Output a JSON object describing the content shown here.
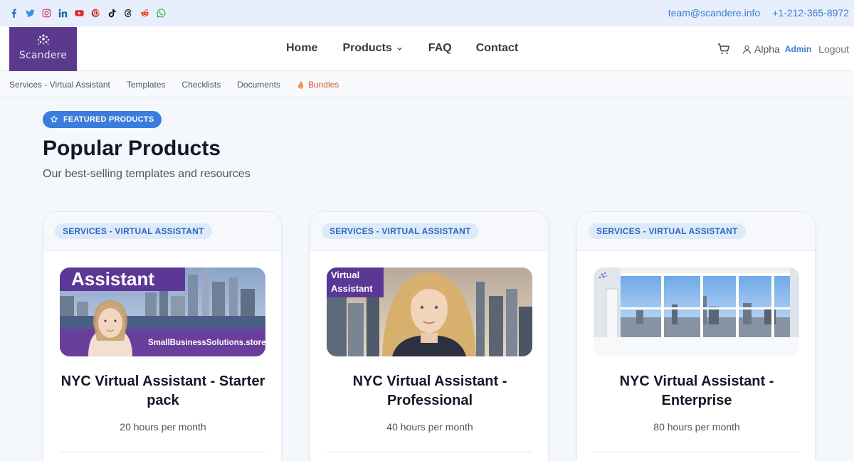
{
  "topbar": {
    "socials": [
      "facebook-icon",
      "twitter-icon",
      "instagram-icon",
      "linkedin-icon",
      "youtube-icon",
      "pinterest-icon",
      "tiktok-icon",
      "threads-icon",
      "reddit-icon",
      "whatsapp-icon"
    ],
    "email": "team@scandere.info",
    "phone": "+1-212-365-8972"
  },
  "brand": {
    "name": "Scandere"
  },
  "nav": {
    "home": "Home",
    "products": "Products",
    "faq": "FAQ",
    "contact": "Contact"
  },
  "user": {
    "name": "Alpha",
    "admin_label": "Admin",
    "logout_label": "Logout"
  },
  "subnav": {
    "items": [
      "Services - Virtual Assistant",
      "Templates",
      "Checklists",
      "Documents"
    ],
    "bundles": "Bundles"
  },
  "featured": {
    "badge": "FEATURED PRODUCTS",
    "title": "Popular Products",
    "subtitle": "Our best-selling templates and resources"
  },
  "products": [
    {
      "category": "SERVICES - VIRTUAL ASSISTANT",
      "title": "NYC Virtual Assistant - Starter pack",
      "description": "20 hours per month",
      "image_caption": "Assistant",
      "image_footer": "SmallBusinessSolutions.store"
    },
    {
      "category": "SERVICES - VIRTUAL ASSISTANT",
      "title": "NYC Virtual Assistant - Professional",
      "description": "40 hours per month",
      "image_caption_line1": "Virtual",
      "image_caption_line2": "Assistant"
    },
    {
      "category": "SERVICES - VIRTUAL ASSISTANT",
      "title": "NYC Virtual Assistant - Enterprise",
      "description": "80 hours per month"
    }
  ],
  "colors": {
    "accent": "#3b7ddd",
    "brand": "#5b3a8e",
    "bundles": "#d45a2a"
  }
}
